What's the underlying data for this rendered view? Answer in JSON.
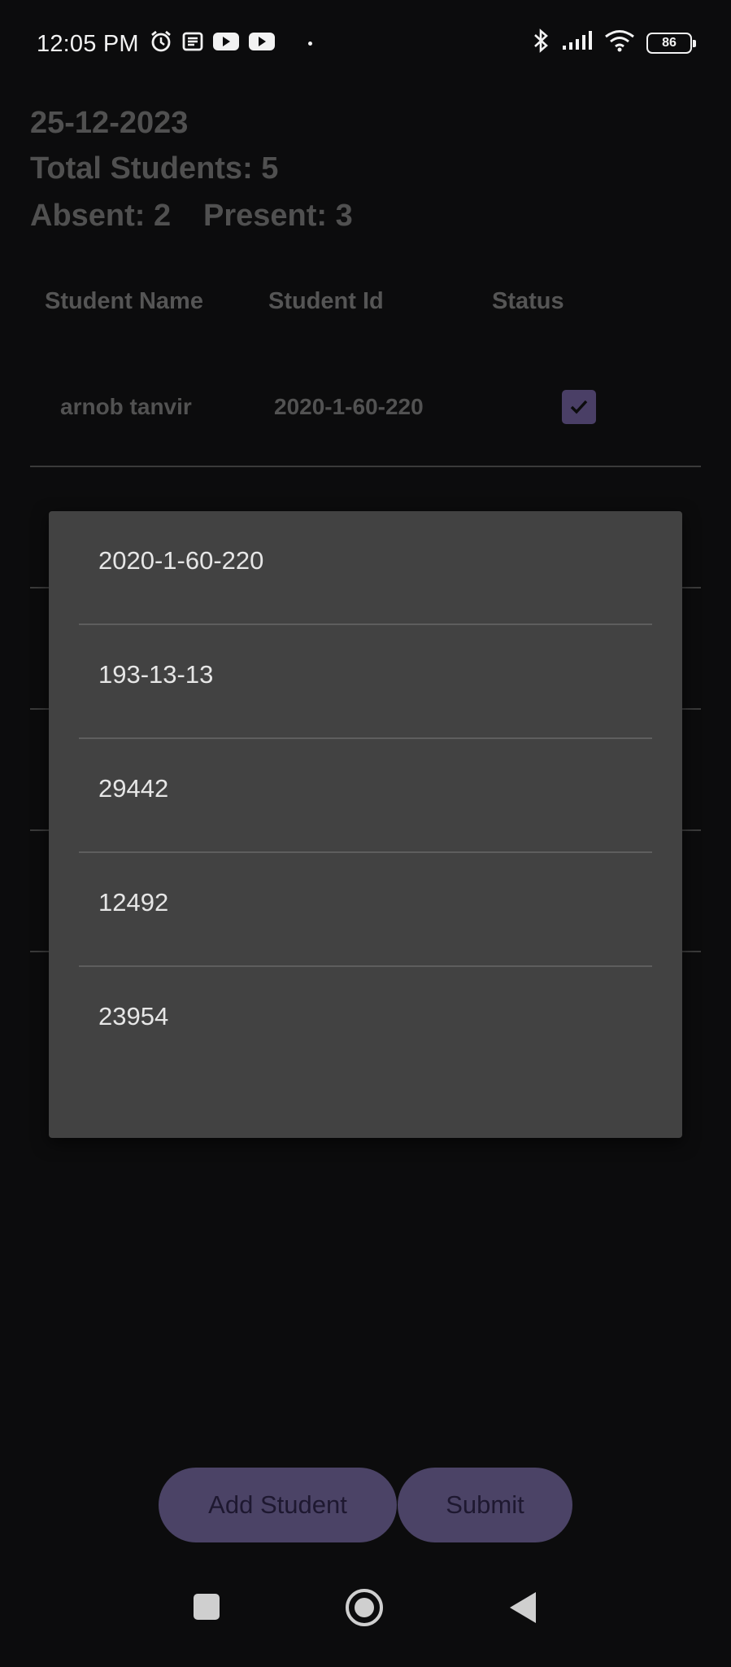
{
  "status_bar": {
    "time": "12:05 PM",
    "battery": "86",
    "left_icons": [
      "alarm-icon",
      "news-icon",
      "youtube-icon",
      "youtube-icon"
    ],
    "right_icons": [
      "bluetooth-icon",
      "signal-icon",
      "wifi-icon",
      "battery-icon"
    ]
  },
  "header": {
    "date": "25-12-2023",
    "total": "Total Students: 5",
    "absent": "Absent: 2",
    "present": "Present: 3"
  },
  "table": {
    "columns": [
      "Student Name",
      "Student Id",
      "Status"
    ],
    "rows": [
      {
        "name": "arnob tanvir",
        "id": "2020-1-60-220",
        "checked": true
      }
    ]
  },
  "dropdown": {
    "options": [
      "2020-1-60-220",
      "193-13-13",
      "29442",
      "12492",
      "23954"
    ]
  },
  "buttons": {
    "add_student": "Add Student",
    "submit": "Submit"
  },
  "colors": {
    "background": "#0c0c0d",
    "popup": "#424242",
    "button": "#4b4366",
    "checkbox": "#4a3f66"
  }
}
